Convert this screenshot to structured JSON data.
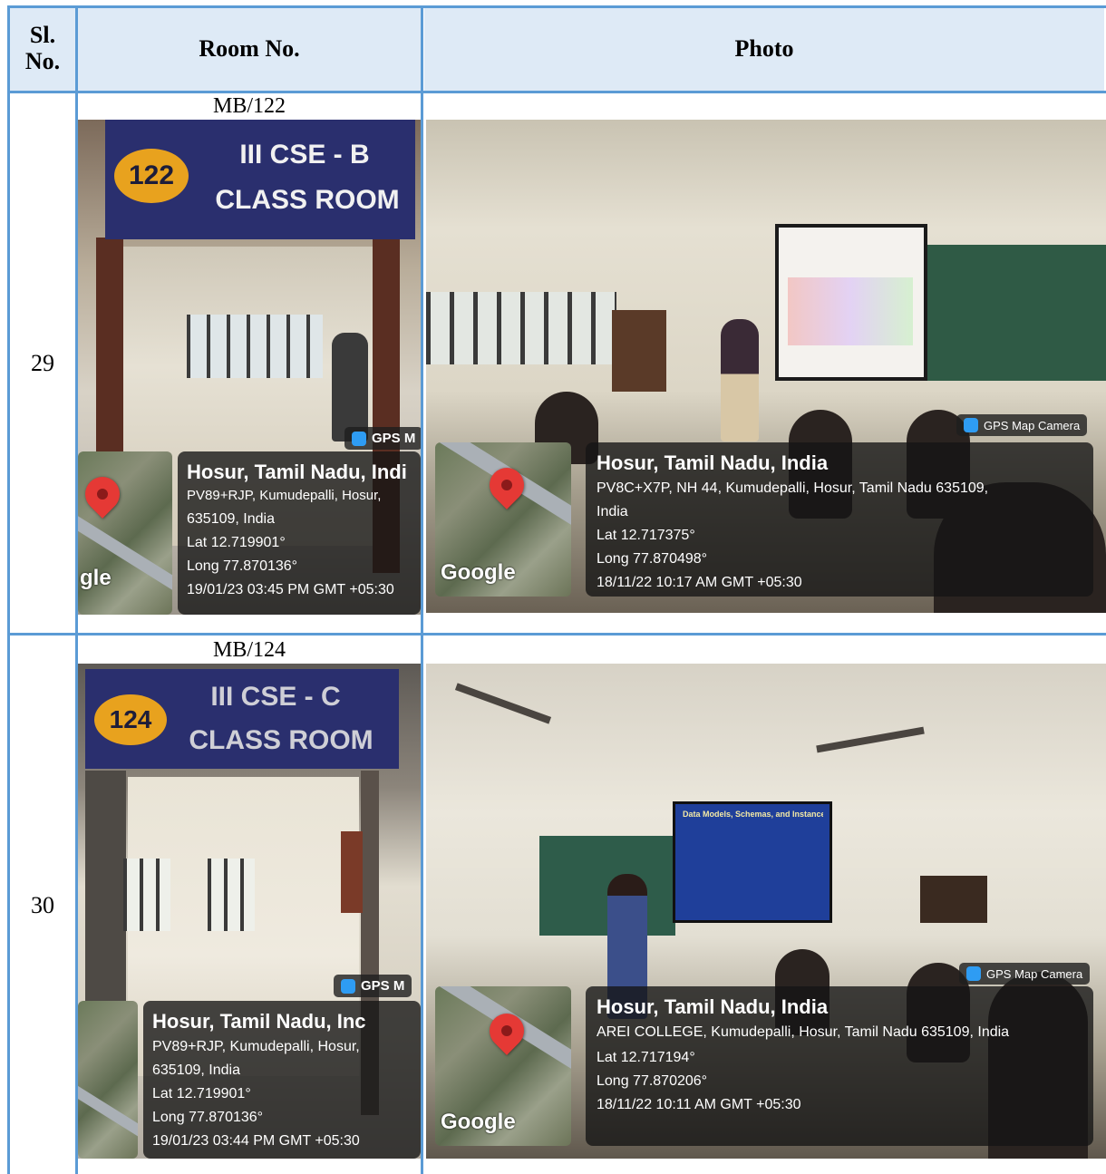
{
  "table": {
    "headers": {
      "sl_no": "Sl.\nNo.",
      "room_no": "Room No.",
      "photo": "Photo"
    },
    "rows": [
      {
        "sl_no": "29",
        "room": "MB/122",
        "door_sign": {
          "number": "122",
          "line1": "III CSE  - B",
          "line2": "CLASS ROOM"
        },
        "door_gps": {
          "camera": "GPS M",
          "title": "Hosur, Tamil Nadu, Indi",
          "address1": "PV89+RJP, Kumudepalli, Hosur,",
          "address2": "635109, India",
          "lat": "Lat 12.719901°",
          "long": "Long 77.870136°",
          "timestamp": "19/01/23 03:45 PM GMT +05:30",
          "google": "gle"
        },
        "class_gps": {
          "camera": "GPS Map Camera",
          "title": "Hosur, Tamil Nadu, India",
          "address1": "PV8C+X7P, NH 44, Kumudepalli, Hosur, Tamil Nadu 635109,",
          "address2": "India",
          "lat": "Lat 12.717375°",
          "long": "Long 77.870498°",
          "timestamp": "18/11/22 10:17 AM GMT +05:30",
          "google": "Google"
        }
      },
      {
        "sl_no": "30",
        "room": "MB/124",
        "door_sign": {
          "number": "124",
          "line1": "III CSE - C",
          "line2": "CLASS ROOM"
        },
        "door_gps": {
          "camera": "GPS M",
          "title": "Hosur, Tamil Nadu, Inc",
          "address1": "PV89+RJP, Kumudepalli, Hosur,",
          "address2": "635109, India",
          "lat": "Lat 12.719901°",
          "long": "Long 77.870136°",
          "timestamp": "19/01/23 03:44 PM GMT +05:30",
          "google": ""
        },
        "class_gps": {
          "camera": "GPS Map Camera",
          "title": "Hosur, Tamil Nadu, India",
          "address1": "AREI COLLEGE, Kumudepalli, Hosur, Tamil Nadu 635109, India",
          "address2": "",
          "lat": "Lat 12.717194°",
          "long": "Long 77.870206°",
          "timestamp": "18/11/22 10:11 AM GMT +05:30",
          "google": "Google"
        },
        "slide_title": "Data Models, Schemas, and Instances"
      }
    ]
  },
  "colors": {
    "grid": "#5b9bd5",
    "header_bg": "#deeaf6",
    "sign_bg": "#2a2f6e",
    "sign_badge": "#e8a21e"
  }
}
